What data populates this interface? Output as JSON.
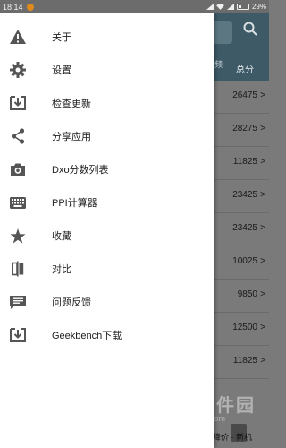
{
  "status_bar": {
    "time": "18:14",
    "battery": "29%"
  },
  "background": {
    "column_headers": [
      "频",
      "总分"
    ],
    "scores": [
      "26475",
      "28275",
      "11825",
      "23425",
      "23425",
      "10025",
      "9850",
      "12500",
      "11825"
    ],
    "chevron": ">",
    "bottom_bar_text": "降价 · 新机"
  },
  "watermark": {
    "name": "当下软件园",
    "url": "www.downxia.com"
  },
  "drawer": {
    "items": [
      {
        "label": "关于",
        "icon": "warning-icon"
      },
      {
        "label": "设置",
        "icon": "gear-icon"
      },
      {
        "label": "检查更新",
        "icon": "download-box-icon"
      },
      {
        "label": "分享应用",
        "icon": "share-icon"
      },
      {
        "label": "Dxo分数列表",
        "icon": "camera-icon"
      },
      {
        "label": "PPI计算器",
        "icon": "keyboard-icon"
      },
      {
        "label": "收藏",
        "icon": "star-icon"
      },
      {
        "label": "对比",
        "icon": "compare-icon"
      },
      {
        "label": "问题反馈",
        "icon": "feedback-icon"
      },
      {
        "label": "Geekbench下载",
        "icon": "download-box-icon"
      }
    ]
  },
  "colors": {
    "header": "#3d5a66",
    "drawer_bg": "#ffffff",
    "icon": "#555555"
  }
}
